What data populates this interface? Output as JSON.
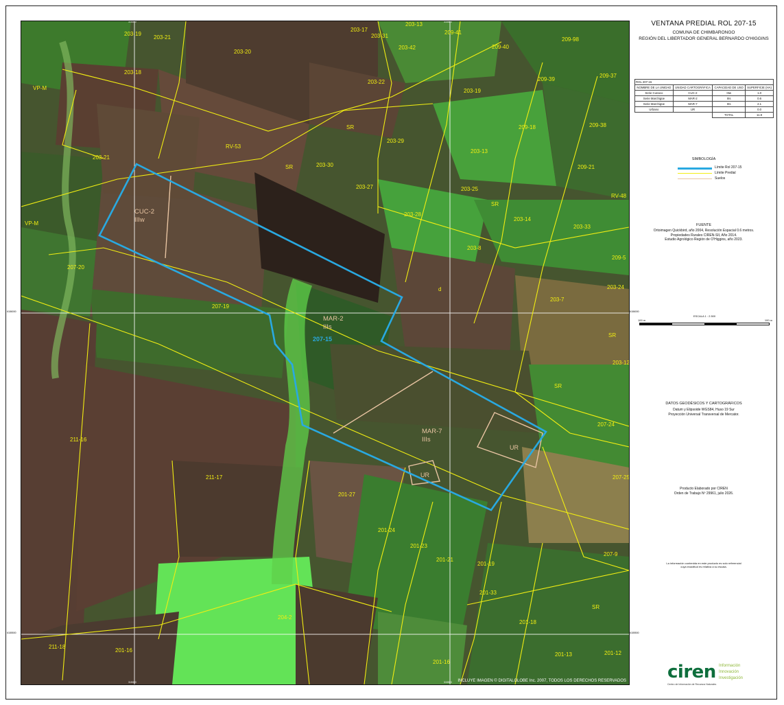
{
  "header": {
    "title": "VENTANA PREDIAL  ROL 207-15",
    "comuna": "COMUNA DE CHIMBARONGO",
    "region": "REGIÓN DEL LIBERTADOR GENERAL BERNARDO O'HIGGINS"
  },
  "units_table": {
    "caption": "ROL 207-15",
    "headers": [
      "NOMBRE DE LA UNIDAD",
      "UNIDAD CARTOGRÁFICA",
      "CAPACIDAD DE USO",
      "SUPERFICIE (HA)"
    ],
    "rows": [
      [
        "Serie Cunaco",
        "CUC-2",
        "IIIw",
        "1.0"
      ],
      [
        "Serie Marchigüe",
        "MAR-2",
        "IIIs",
        "0.6"
      ],
      [
        "Serie Marchigüe",
        "MAR-7",
        "IIIs",
        "2.1"
      ],
      [
        "Urbano",
        "UR",
        "",
        "0.0"
      ]
    ],
    "total_label": "TOTAL",
    "total_value": "11.9"
  },
  "legend": {
    "title": "SIMBOLOGÍA",
    "items": [
      {
        "label": "Límite Rol 207-15",
        "color": "#29a9e1"
      },
      {
        "label": "Límite Predial",
        "color": "#f2ee12"
      },
      {
        "label": "Suelos",
        "color": "#e8c4a2"
      }
    ]
  },
  "source": {
    "title": "FUENTE",
    "lines": [
      "Ortoimagen Quickbird, año 2004, Resolución Espacial 0.6 metros.",
      "Propiedades Rurales CIREN-SII, Año 2014.",
      "Estudio Agrológico Región de O'Higgins, año 2023."
    ]
  },
  "scale": {
    "title": "ESCALA  1 : 2.500",
    "left": "100 m",
    "right": "100 m"
  },
  "geodesy": {
    "title": "DATOS GEODÉSICOS Y CARTOGRÁFICOS",
    "lines": [
      "Datum y Elipsoide WGS84, Huso 19 Sur",
      "Proyección Universal Transversal de Mercator."
    ]
  },
  "producer": {
    "lines": [
      "Producto Elaborado por CIREN",
      "Orden de Trabajo Nº 29961, julio 2026."
    ]
  },
  "disclaimer": {
    "lines": [
      "La información contenida en este producto es solo referencial",
      "cuya exactitud es relativa a su escala."
    ]
  },
  "logo": {
    "word": "ciren",
    "tagline": [
      "Información",
      "Innovación",
      "Investigación"
    ],
    "small": "Centro de Información de Recursos Naturales"
  },
  "map": {
    "copyright": "INCLUYE IMAGEN © DIGITALGLOBE Inc. 2007, TODOS LOS DERECHOS RESERVADOS",
    "grid_labels": {
      "top": [
        "315000",
        "315500"
      ],
      "bottom": [
        "315000",
        "315500"
      ],
      "left": [
        "6186000",
        "6185500"
      ],
      "right": [
        "6186000",
        "6185500"
      ]
    },
    "parcel_labels": [
      "203-19",
      "203-21",
      "203-17",
      "203-31",
      "203-13",
      "209-41",
      "209-98",
      "203-20",
      "203-42",
      "209-40",
      "203-18",
      "203-22",
      "209-39",
      "209-37",
      "VP-M",
      "203-19",
      "RV-53",
      "SR",
      "203-29",
      "209-18",
      "209-38",
      "203-21",
      "SR",
      "203-30",
      "203-27",
      "203-13",
      "209-21",
      "203-25",
      "SR",
      "203-14",
      "RV-48",
      "VP-M",
      "203-28",
      "203-33",
      "207-20",
      "203-8",
      "209-5",
      "d",
      "203-24",
      "207-19",
      "203-7",
      "SR",
      "203-12",
      "SR",
      "207-24",
      "211-16",
      "211-17",
      "207-25",
      "201-27",
      "201-24",
      "201-23",
      "201-21",
      "201-19",
      "207-9",
      "201-33",
      "SR",
      "204-2",
      "201-18",
      "211-18",
      "201-16",
      "201-13",
      "201-12",
      "201-16"
    ],
    "soil_labels": [
      {
        "unit": "CUC-2",
        "class": "IIIw"
      },
      {
        "unit": "MAR-2",
        "class": "IIIs"
      },
      {
        "unit": "MAR-7",
        "class": "IIIs"
      }
    ],
    "rol_label": "207-15",
    "ur_labels": [
      "UR",
      "UR"
    ]
  }
}
